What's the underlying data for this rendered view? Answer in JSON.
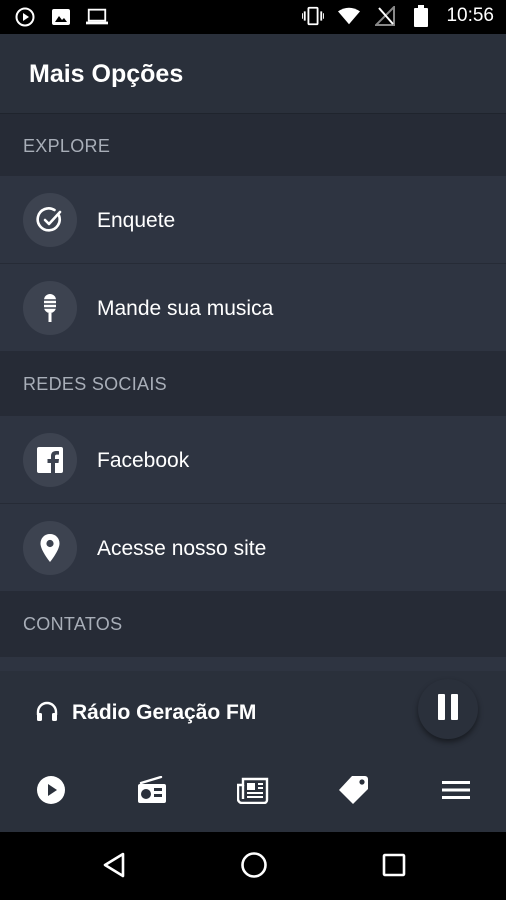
{
  "status_bar": {
    "time": "10:56",
    "left_icons": [
      "play-circle-icon",
      "image-icon",
      "laptop-icon"
    ],
    "right_icons": [
      "vibrate-icon",
      "wifi-icon",
      "no-signal-icon",
      "battery-icon"
    ]
  },
  "header": {
    "title": "Mais Opções"
  },
  "sections": {
    "explore": {
      "title": "EXPLORE",
      "items": [
        {
          "label": "Enquete",
          "icon": "check-circle-icon"
        },
        {
          "label": "Mande sua musica",
          "icon": "microphone-icon"
        }
      ]
    },
    "social": {
      "title": "REDES SOCIAIS",
      "items": [
        {
          "label": "Facebook",
          "icon": "facebook-icon"
        },
        {
          "label": "Acesse nosso site",
          "icon": "map-pin-icon"
        }
      ]
    },
    "contacts": {
      "title": "CONTATOS"
    }
  },
  "player": {
    "station": "Rádio Geração FM",
    "icon": "headphones-icon",
    "state_icon": "pause-icon"
  },
  "bottom_nav": {
    "items": [
      "play-icon",
      "radio-icon",
      "news-icon",
      "tag-icon",
      "menu-icon"
    ]
  },
  "system_nav": {
    "items": [
      "back-icon",
      "home-icon",
      "recents-icon"
    ]
  },
  "colors": {
    "background": "#262b36",
    "row": "#2e3441",
    "bar": "#2a303b",
    "icon_circle": "#3d4350",
    "section_text": "#a8aeb8"
  }
}
